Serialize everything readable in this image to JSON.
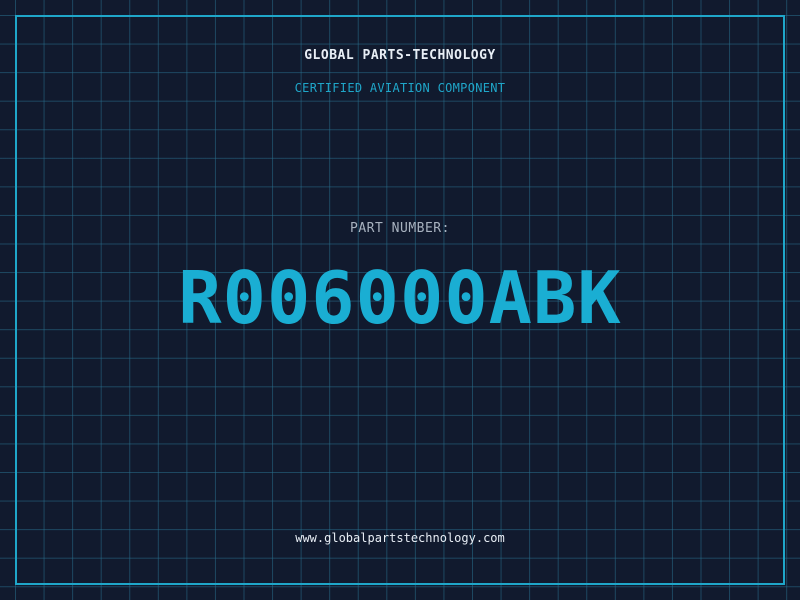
{
  "header": {
    "company": "GLOBAL PARTS-TECHNOLOGY",
    "tagline": "CERTIFIED AVIATION COMPONENT"
  },
  "part": {
    "label": "PART NUMBER:",
    "number": "R006000ABK"
  },
  "footer": {
    "website": "www.globalpartstechnology.com"
  },
  "colors": {
    "background": "#111a2e",
    "grid": "#286e8c",
    "accent": "#1fa6c9",
    "text": "#e8eef5",
    "muted": "#a8b2bf"
  }
}
